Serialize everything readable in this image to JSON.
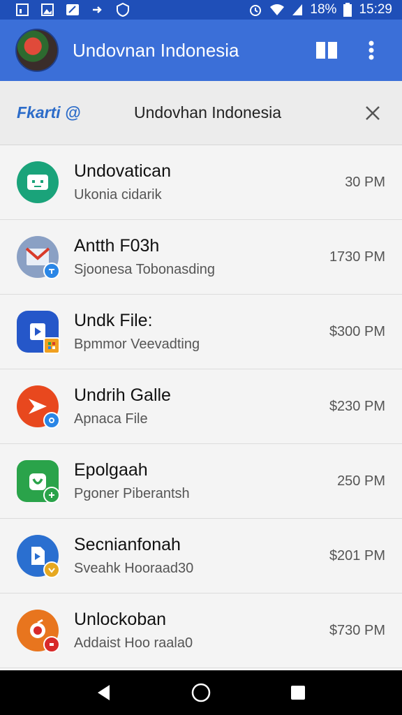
{
  "status": {
    "battery": "18%",
    "time": "15:29"
  },
  "app_bar": {
    "title": "Undovnan Indonesia"
  },
  "search": {
    "brand": "Fkarti @",
    "query": "Undovhan Indonesia"
  },
  "items": [
    {
      "title": "Undovatican",
      "subtitle": "Ukonia cidarik",
      "time": "30 PM",
      "icon_color": "#1aa37a",
      "badge_color": ""
    },
    {
      "title": "Antth F03h",
      "subtitle": "Sjoonesa Tobonasding",
      "time": "1730 PM",
      "icon_color": "#8aa0c4",
      "badge_color": "#2a86e6"
    },
    {
      "title": "Undk File:",
      "subtitle": "Bpmmor Veevadting",
      "time": "$300 PM",
      "icon_color": "#2557c9",
      "badge_color": "#f0a020"
    },
    {
      "title": "Undrih Galle",
      "subtitle": "Apnaca File",
      "time": "$230 PM",
      "icon_color": "#e8481e",
      "badge_color": "#2a86e6"
    },
    {
      "title": "Epolgaah",
      "subtitle": "Pgoner Piberantsh",
      "time": "250 PM",
      "icon_color": "#2aa34a",
      "badge_color": "#2aa34a"
    },
    {
      "title": "Secnianfonah",
      "subtitle": "Sveahk Hooraad30",
      "time": "$201 PM",
      "icon_color": "#2a6fd0",
      "badge_color": "#e6a820"
    },
    {
      "title": "Unlockoban",
      "subtitle": "Addaist Hoo raala0",
      "time": "$730 PM",
      "icon_color": "#e8751e",
      "badge_color": "#d82a2a"
    }
  ],
  "colors": {
    "status_bar": "#1f4fb8",
    "app_bar": "#3b6fd8",
    "accent": "#2c6cc9"
  }
}
